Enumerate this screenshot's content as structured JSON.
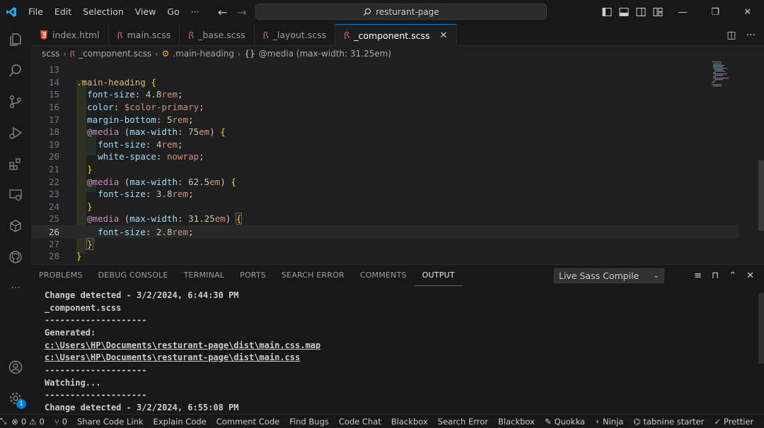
{
  "titlebar": {
    "menu": [
      "File",
      "Edit",
      "Selection",
      "View",
      "Go",
      "···"
    ],
    "search": "resturant-page"
  },
  "tabs": [
    {
      "label": "index.html",
      "icon": "html-file-icon",
      "active": false
    },
    {
      "label": "main.scss",
      "icon": "scss-file-icon",
      "active": false
    },
    {
      "label": "_base.scss",
      "icon": "scss-file-icon",
      "active": false
    },
    {
      "label": "_layout.scss",
      "icon": "scss-file-icon",
      "active": false
    },
    {
      "label": "_component.scss",
      "icon": "scss-file-icon",
      "active": true
    }
  ],
  "breadcrumb": [
    "scss",
    "_component.scss",
    ".main-heading",
    "@media (max-width: 31.25em)"
  ],
  "editor": {
    "line_numbers": [
      "13",
      "14",
      "15",
      "16",
      "17",
      "18",
      "19",
      "20",
      "21",
      "22",
      "23",
      "24",
      "25",
      "26",
      "27",
      "28"
    ],
    "current_line": "26"
  },
  "panel": {
    "tabs": [
      "PROBLEMS",
      "DEBUG CONSOLE",
      "TERMINAL",
      "PORTS",
      "SEARCH ERROR",
      "COMMENTS",
      "OUTPUT"
    ],
    "active_tab": "OUTPUT",
    "channel": "Live Sass Compile",
    "output": [
      "Change detected - 3/2/2024, 6:44:30 PM",
      "_component.scss",
      "--------------------",
      "Generated:",
      "c:\\Users\\HP\\Documents\\resturant-page\\dist\\main.css.map",
      "c:\\Users\\HP\\Documents\\resturant-page\\dist\\main.css",
      "--------------------",
      "Watching...",
      "--------------------",
      "Change detected - 3/2/2024, 6:55:08 PM"
    ]
  },
  "statusbar": {
    "errors": "0",
    "warnings": "0",
    "ports": "0",
    "left_items": [
      "Share Code Link",
      "Explain Code",
      "Comment Code",
      "Find Bugs",
      "Code Chat",
      "Blackbox",
      "Search Error"
    ],
    "right_items": [
      "Blackbox",
      "Quokka",
      "Ninja",
      "tabnine starter",
      "Prettier"
    ]
  },
  "accounts_badge": "1",
  "colors": {
    "accent": "#0078d4",
    "background": "#1f1f1f",
    "chrome": "#181818"
  }
}
